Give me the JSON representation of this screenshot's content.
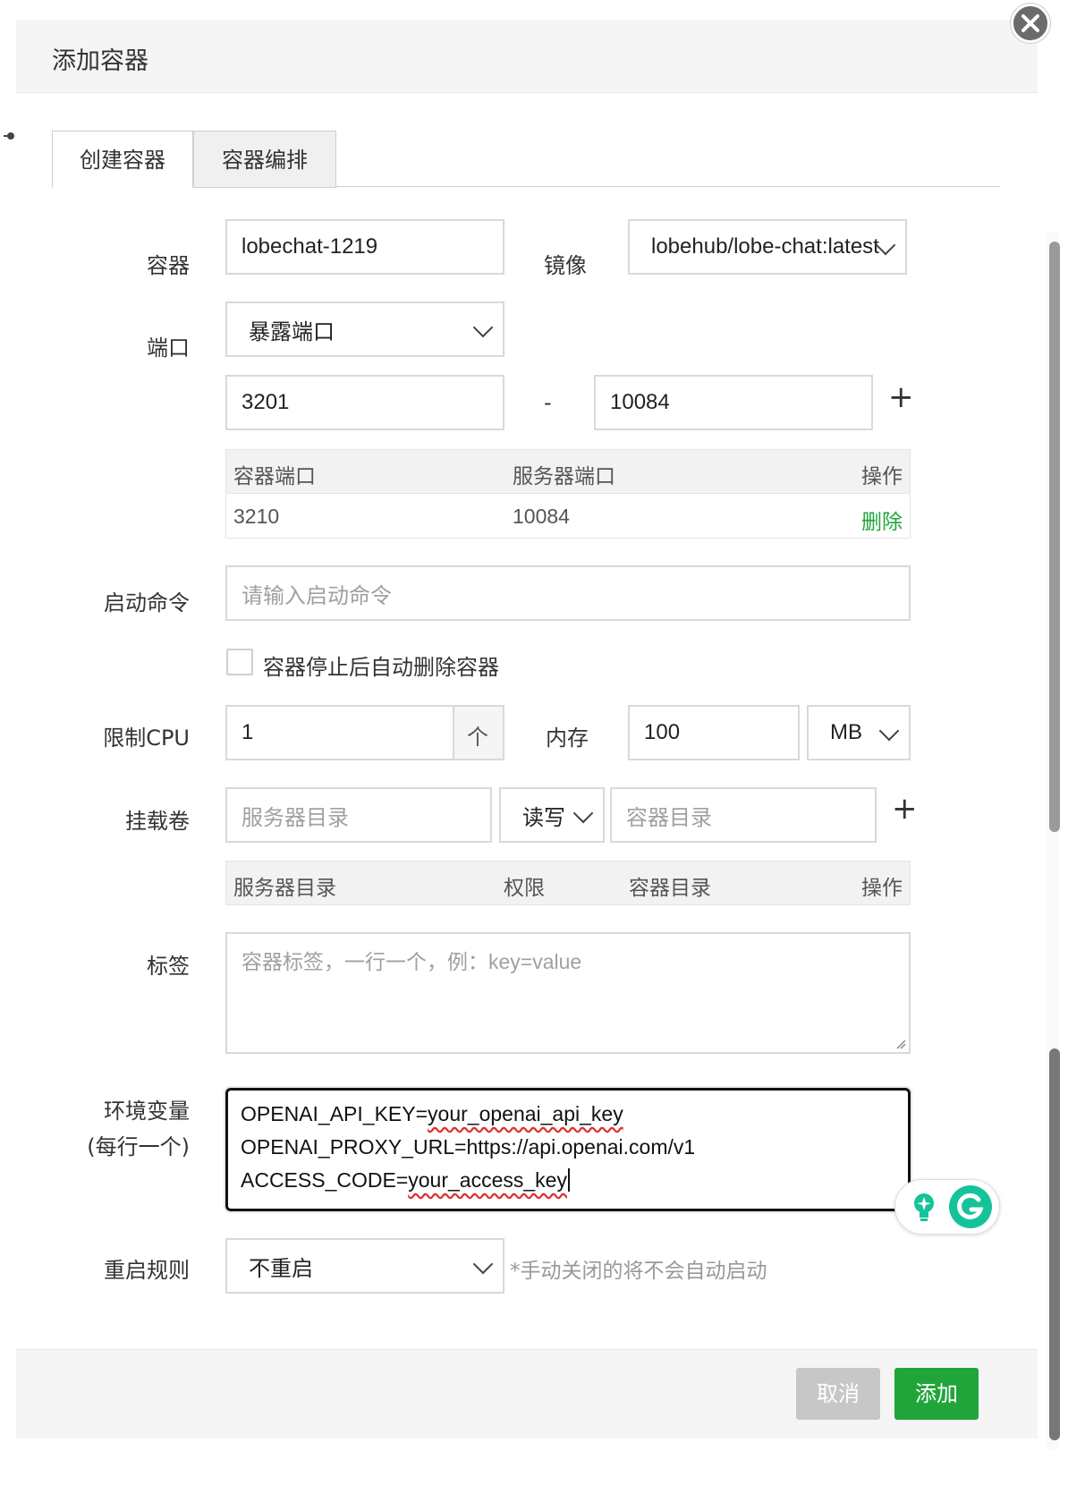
{
  "dialog": {
    "title": "添加容器"
  },
  "tabs": [
    {
      "label": "创建容器"
    },
    {
      "label": "容器编排"
    }
  ],
  "form": {
    "container": {
      "label": "容器",
      "value": "lobechat-1219"
    },
    "image": {
      "label": "镜像",
      "value": "lobehub/lobe-chat:latest"
    },
    "port": {
      "label": "端口",
      "mode": "暴露端口",
      "container_port": "3201",
      "separator": "-",
      "server_port": "10084",
      "add_symbol": "+",
      "table": {
        "headers": [
          "容器端口",
          "服务器端口",
          "操作"
        ],
        "rows": [
          {
            "container": "3210",
            "server": "10084",
            "action": "删除"
          }
        ]
      }
    },
    "command": {
      "label": "启动命令",
      "placeholder": "请输入启动命令"
    },
    "auto_remove": {
      "label": "容器停止后自动删除容器",
      "checked": false
    },
    "cpu": {
      "label": "限制CPU",
      "value": "1",
      "step_symbol": "个"
    },
    "memory": {
      "label": "内存",
      "value": "100",
      "unit": "MB"
    },
    "volume": {
      "label": "挂载卷",
      "server_dir_placeholder": "服务器目录",
      "permission": "读写",
      "container_dir_placeholder": "容器目录",
      "add_symbol": "+",
      "table": {
        "headers": [
          "服务器目录",
          "权限",
          "容器目录",
          "操作"
        ]
      }
    },
    "labels": {
      "label": "标签",
      "placeholder": "容器标签，一行一个，例：key=value"
    },
    "env": {
      "label": "环境变量",
      "sublabel": "(每行一个)",
      "lines": [
        {
          "key": "OPENAI_API_KEY=",
          "value": "your_openai_api_key"
        },
        {
          "key": "OPENAI_PROXY_URL=https://api.openai.com/v1",
          "value": ""
        },
        {
          "key": "ACCESS_CODE=",
          "value": "your_access_key"
        }
      ]
    },
    "restart": {
      "label": "重启规则",
      "value": "不重启",
      "hint": "*手动关闭的将不会自动启动"
    }
  },
  "footer": {
    "cancel_label": "取消",
    "add_label": "添加"
  },
  "colors": {
    "accent": "#20a53a",
    "cancel_bg": "#c7c7c7",
    "grammarly": "#15c39a"
  }
}
